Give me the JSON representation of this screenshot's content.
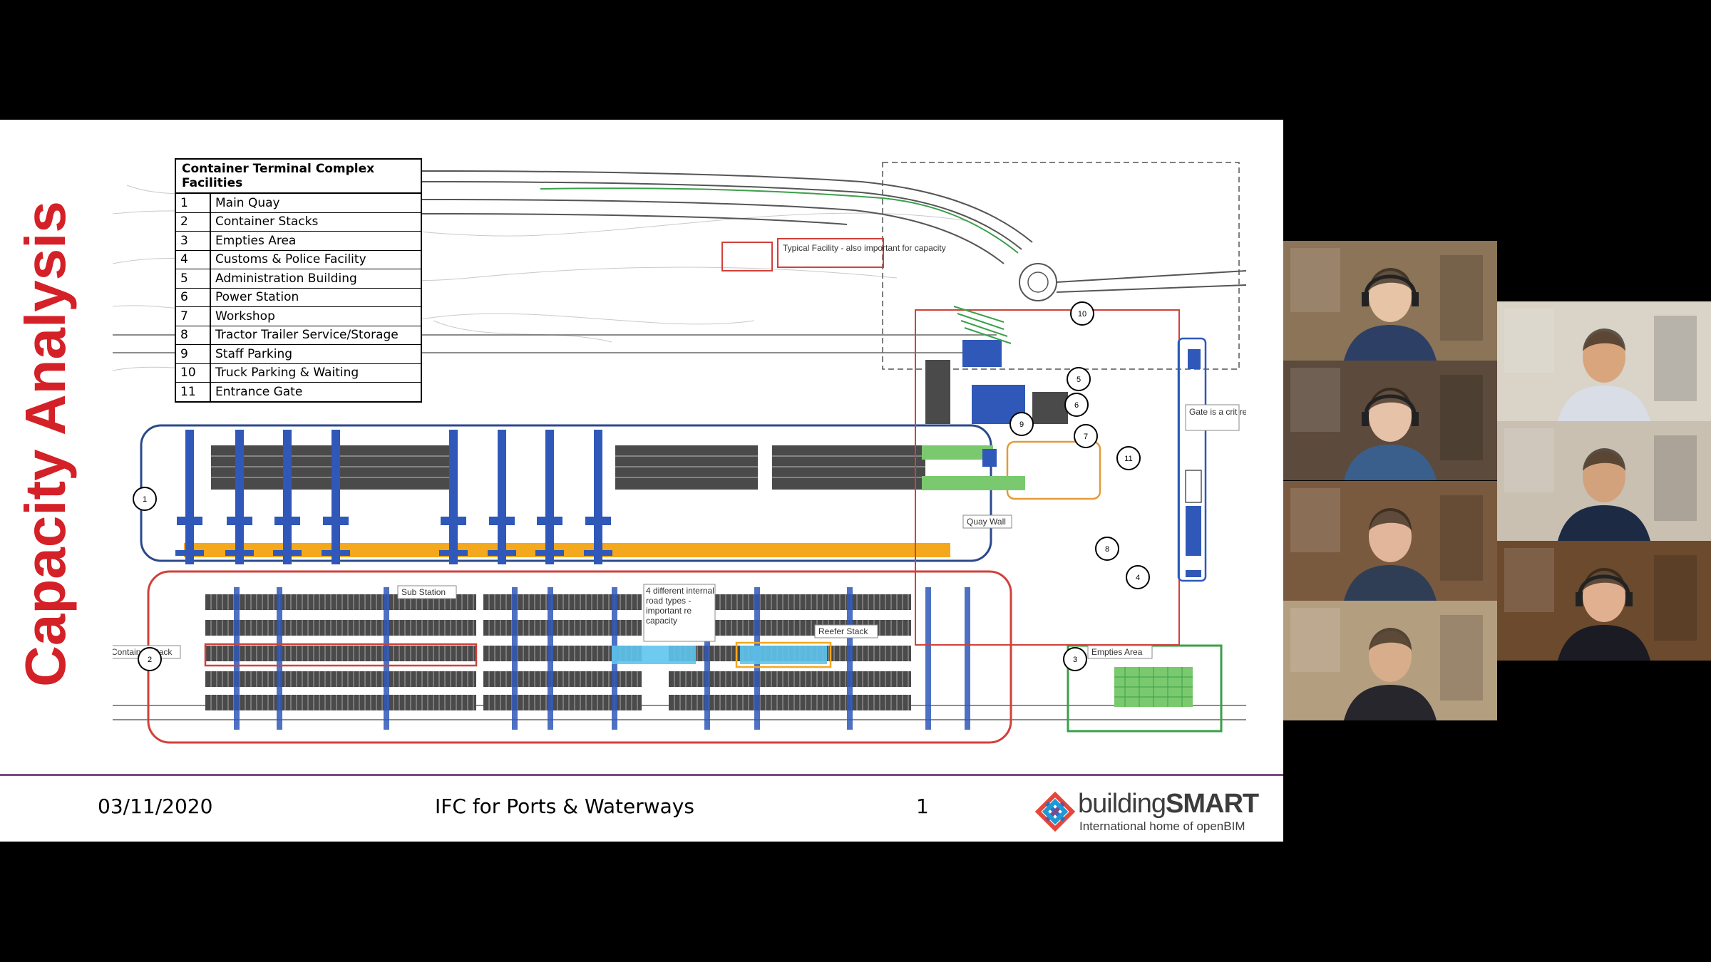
{
  "slide": {
    "title": "Capacity Analysis",
    "legend": {
      "header": "Container Terminal Complex Facilities",
      "rows": [
        {
          "num": "1",
          "label": "Main Quay"
        },
        {
          "num": "2",
          "label": "Container Stacks"
        },
        {
          "num": "3",
          "label": "Empties Area"
        },
        {
          "num": "4",
          "label": "Customs & Police Facility"
        },
        {
          "num": "5",
          "label": "Administration Building"
        },
        {
          "num": "6",
          "label": "Power Station"
        },
        {
          "num": "7",
          "label": "Workshop"
        },
        {
          "num": "8",
          "label": "Tractor Trailer Service/Storage"
        },
        {
          "num": "9",
          "label": "Staff Parking"
        },
        {
          "num": "10",
          "label": "Truck Parking & Waiting"
        },
        {
          "num": "11",
          "label": "Entrance Gate"
        }
      ]
    },
    "plan_labels": {
      "typical_facility": "Typical Facility - also important for capacity",
      "quay_wall": "Quay Wall",
      "sub_station": "Sub Station",
      "road_types": "4 different internal road types - important re capacity",
      "reefer_stack": "Reefer Stack",
      "container_stack": "Container Stack",
      "empties_area": "Empties Area",
      "gate_note": "Gate is a crit re capacity"
    },
    "markers": [
      "1",
      "2",
      "3",
      "4",
      "5",
      "6",
      "7",
      "8",
      "9",
      "10",
      "11"
    ],
    "footer": {
      "date": "03/11/2020",
      "center": "IFC for Ports & Waterways",
      "page": "1"
    },
    "logo": {
      "word_light": "building",
      "word_bold": "SMART",
      "tagline": "International home of openBIM"
    }
  },
  "colors": {
    "title_red": "#d42027",
    "footer_line": "#7b4a8a",
    "quay_blue": "#2b4a8c",
    "crane_blue": "#2f58b8",
    "quay_orange": "#f4a81d",
    "stack_red": "#d0413a",
    "reefer_cyan": "#5fc4ee",
    "empties_green": "#3aa04a"
  },
  "participants": [
    {
      "id": "p1",
      "icon": "person-headset-icon"
    },
    {
      "id": "p2",
      "icon": "person-icon"
    },
    {
      "id": "p3",
      "icon": "person-headset-icon"
    },
    {
      "id": "p4",
      "icon": "person-icon"
    },
    {
      "id": "p5",
      "icon": "person-icon"
    },
    {
      "id": "p6",
      "icon": "person-headset-icon"
    },
    {
      "id": "p7",
      "icon": "person-icon"
    }
  ]
}
